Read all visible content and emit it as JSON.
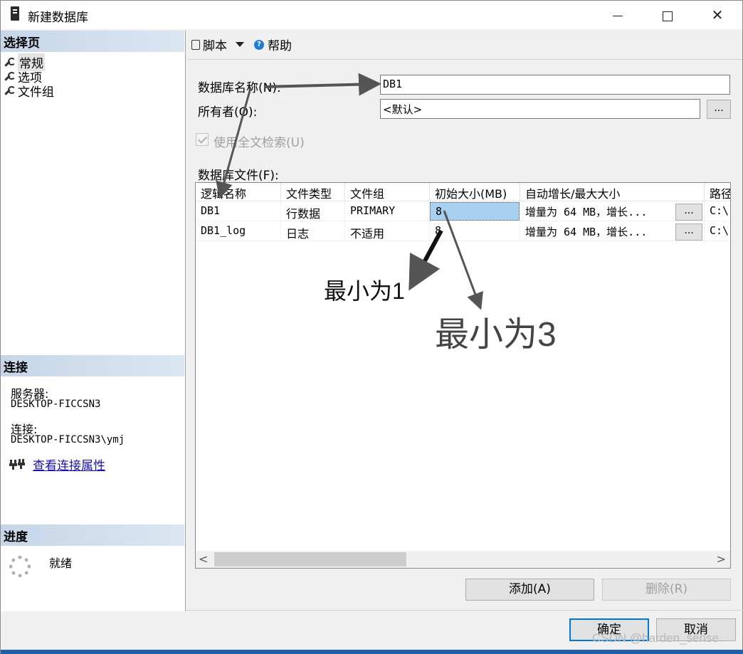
{
  "window": {
    "title": "新建数据库"
  },
  "left_pane": {
    "select_page_header": "选择页",
    "nav_items": [
      {
        "label": "常规",
        "icon": "wrench-icon"
      },
      {
        "label": "选项",
        "icon": "wrench-icon"
      },
      {
        "label": "文件组",
        "icon": "wrench-icon"
      }
    ],
    "connection_header": "连接",
    "server_label": "服务器:",
    "server_value": "DESKTOP-FICCSN3",
    "connection_label": "连接:",
    "connection_value": "DESKTOP-FICCSN3\\ymj",
    "view_connection_link": "查看连接属性",
    "progress_header": "进度",
    "status": "就绪"
  },
  "toolbar": {
    "script_label": "脚本",
    "help_label": "帮助"
  },
  "form": {
    "db_name_label": "数据库名称(N):",
    "db_name_value": "DB1",
    "owner_label": "所有者(O):",
    "owner_value": "<默认>",
    "owner_browse": "...",
    "fulltext_label": "使用全文检索(U)",
    "fulltext_checked": true,
    "db_files_label": "数据库文件(F):"
  },
  "grid": {
    "columns": [
      "逻辑名称",
      "文件类型",
      "文件组",
      "初始大小(MB)",
      "自动增长/最大大小",
      "路径"
    ],
    "rows": [
      {
        "logical_name": "DB1",
        "file_type": "行数据",
        "filegroup": "PRIMARY",
        "initial_size": "8",
        "autogrowth": "增量为 64 MB，增长...",
        "browse": "...",
        "path": "C:\\"
      },
      {
        "logical_name": "DB1_log",
        "file_type": "日志",
        "filegroup": "不适用",
        "initial_size": "8",
        "autogrowth": "增量为 64 MB，增长...",
        "browse": "...",
        "path": "C:\\"
      }
    ],
    "scroll_left": "<",
    "scroll_right": ">"
  },
  "buttons": {
    "add": "添加(A)",
    "remove": "删除(R)",
    "ok": "确定",
    "cancel": "取消"
  },
  "annotations": {
    "min1": "最小为1",
    "min3": "最小为3"
  },
  "watermark": "CSDN @harden_sense"
}
